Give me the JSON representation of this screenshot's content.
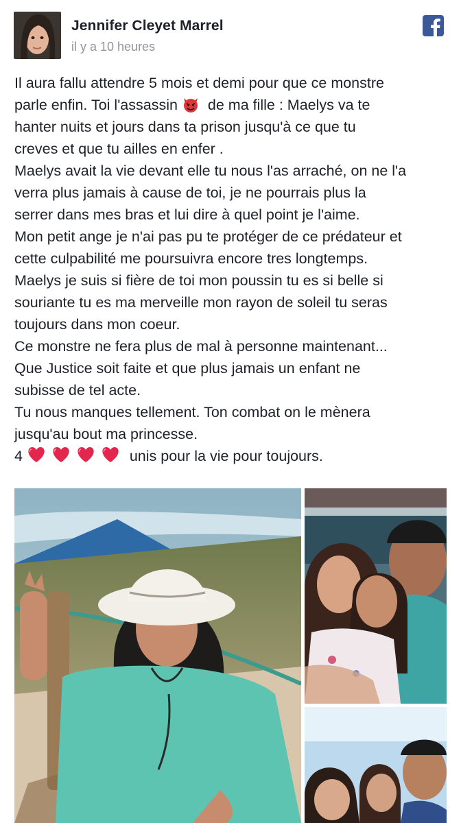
{
  "post": {
    "author": "Jennifer Cleyet Marrel",
    "timestamp": "il y a 10 heures",
    "paragraphs": [
      {
        "before": "Il aura fallu attendre 5 mois et demi pour que ce monstre",
        "after": ""
      },
      {
        "before": "parle enfin. Toi l'assassin",
        "emoji": "smiling-devil-emoji",
        "after": " de ma fille : Maelys va te"
      },
      {
        "before": "hanter nuits et jours dans ta prison jusqu'à ce que tu",
        "after": ""
      },
      {
        "before": "creves et que tu ailles en enfer .",
        "after": ""
      },
      {
        "before": "Maelys avait la vie devant elle tu nous l'as arraché, on ne l'a",
        "after": ""
      },
      {
        "before": "verra plus jamais à cause de toi, je ne pourrais plus la",
        "after": ""
      },
      {
        "before": "serrer dans mes bras et lui dire à quel point je l'aime.",
        "after": ""
      },
      {
        "before": "Mon petit ange je n'ai pas pu te protéger de ce prédateur et",
        "after": ""
      },
      {
        "before": "cette culpabilité me poursuivra encore tres longtemps.",
        "after": ""
      },
      {
        "before": "Maelys je suis si fière de toi mon poussin tu es si belle si",
        "after": ""
      },
      {
        "before": "souriante tu es ma merveille mon rayon de soleil tu seras",
        "after": ""
      },
      {
        "before": "toujours dans mon coeur.",
        "after": ""
      },
      {
        "before": "Ce monstre ne fera plus de mal à personne maintenant...",
        "after": ""
      },
      {
        "before": "Que Justice soit faite et que plus jamais un enfant ne",
        "after": ""
      },
      {
        "before": "subisse de tel acte.",
        "after": ""
      },
      {
        "before": "Tu nous manques tellement. Ton combat on le mènera",
        "after": ""
      },
      {
        "before": "jusqu'au bout ma princesse.",
        "after": ""
      },
      {
        "before": "4 ",
        "hearts": 4,
        "after": " unis pour la vie pour toujours."
      }
    ]
  },
  "icons": {
    "facebook": "facebook-logo-icon",
    "devil": "smiling-devil-emoji",
    "heart": "red-heart-emoji"
  },
  "colors": {
    "author_text": "#1d2129",
    "timestamp_text": "#90949c",
    "facebook_blue": "#3b5998",
    "heart_red": "#e2264d",
    "devil_red": "#d9383a"
  },
  "photos": [
    {
      "name": "girl-in-hat-at-beach"
    },
    {
      "name": "family-on-boat"
    },
    {
      "name": "family-selfie-sky"
    }
  ]
}
